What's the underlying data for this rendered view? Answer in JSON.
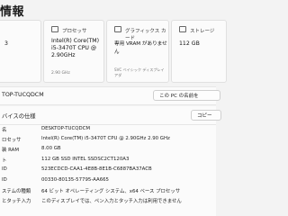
{
  "page": {
    "title": "情報"
  },
  "cards": [
    {
      "label": "",
      "lines": [
        "3"
      ],
      "sub": ""
    },
    {
      "label": "プロセッサ",
      "lines": [
        "Intel(R) Core(TM)",
        "i5-3470T CPU @",
        "2.90GHz"
      ],
      "sub": "2.90 GHz"
    },
    {
      "label": "グラフィックス カード",
      "lines": [
        "専用 VRAM がありません"
      ],
      "sub": "SVC ベイシック ディスプレイ アダ"
    },
    {
      "label": "ストレージ",
      "lines": [
        "112 GB"
      ],
      "sub": ""
    }
  ],
  "device_name_row": {
    "name": "TOP-TUCQDCM",
    "rename_button": "この PC の名前を",
    "copy_button": "コピー"
  },
  "spec_section": {
    "header": "バイスの仕様"
  },
  "specs": [
    {
      "key": "名",
      "value": "DESKTOP-TUCQDCM"
    },
    {
      "key": "ロセッサ",
      "value": "Intel(R) Core(TM) i5-3470T CPU @ 2.90GHz   2.90 GHz"
    },
    {
      "key": "装 RAM",
      "value": "8.00 GB"
    },
    {
      "key": "ト",
      "value": "112 GB SSD INTEL SSDSC2CT120A3"
    },
    {
      "key": "ID",
      "value": "523ECDCD-CAA1-4E8B-8E1B-C6887BA37ACB"
    },
    {
      "key": "ID",
      "value": "00330-80135-57795-AA665"
    },
    {
      "key": "ステムの種類",
      "value": "64 ビット オペレーティング システム、x64 ベース プロセッサ"
    },
    {
      "key": "とタッチ入力",
      "value": "このディスプレイでは、ペン入力とタッチ入力は利用できません"
    }
  ]
}
